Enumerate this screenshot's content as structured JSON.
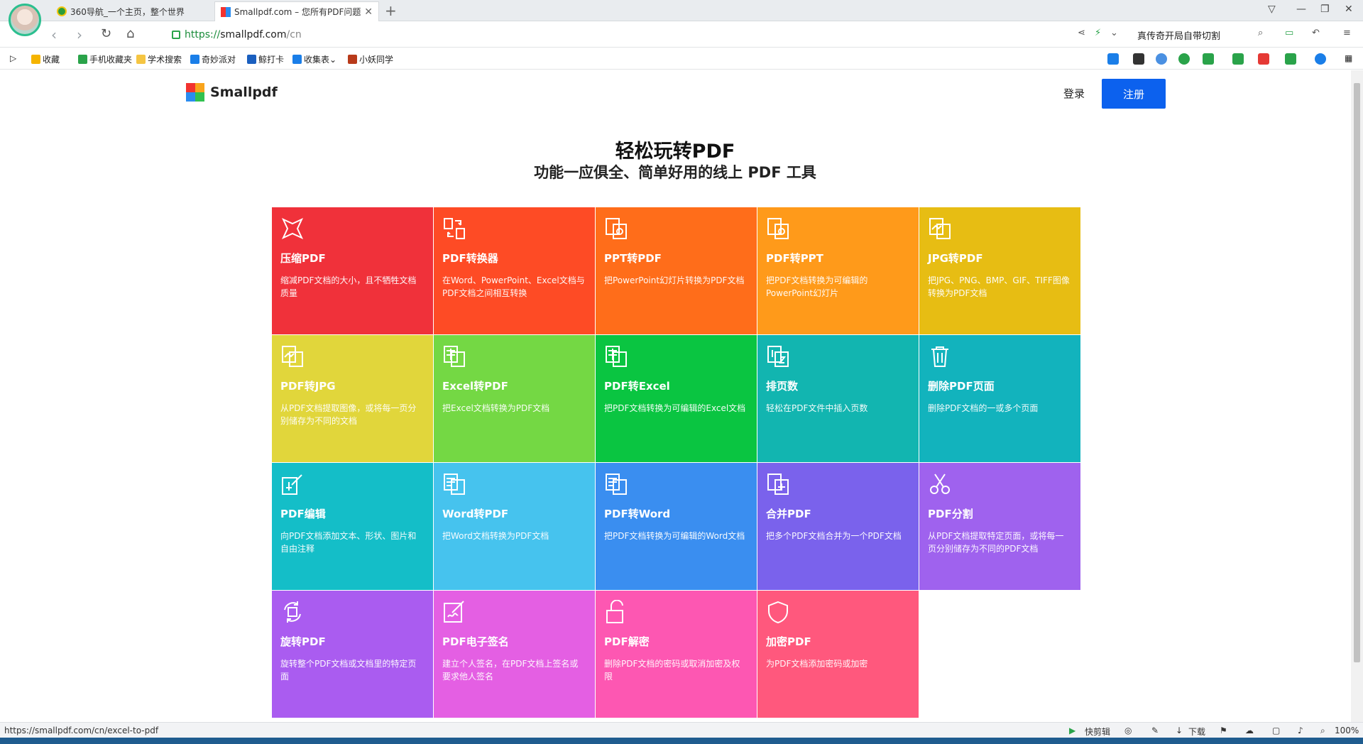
{
  "browser": {
    "tabs": [
      {
        "label": "360导航_一个主页，整个世界"
      },
      {
        "label": "Smallpdf.com – 您所有PDF问题",
        "active": true
      }
    ],
    "url": {
      "scheme": "https://",
      "host": "smallpdf.com",
      "path": "/cn"
    },
    "hot_search": "真传奇开局自带切割",
    "bookmarks": [
      "收藏",
      "手机收藏夹",
      "学术搜索",
      "奇妙派对",
      "鲸打卡",
      "收集表",
      "小妖同学"
    ],
    "status_url": "https://smallpdf.com/cn/excel-to-pdf",
    "status_right": {
      "clip": "快剪辑",
      "download": "下载",
      "zoom": "100%"
    }
  },
  "site": {
    "logo": "Smallpdf",
    "login": "登录",
    "signup": "注册",
    "hero_title": "轻松玩转PDF",
    "hero_subtitle": "功能一应俱全、简单好用的线上 PDF 工具"
  },
  "tools": [
    {
      "title": "压缩PDF",
      "desc": "缩减PDF文档的大小，且不牺牲文档质量",
      "color": "#f0313a",
      "icon": "compress-icon"
    },
    {
      "title": "PDF转换器",
      "desc": "在Word、PowerPoint、Excel文档与PDF文档之间相互转换",
      "color": "#fe4b25",
      "icon": "converter-icon"
    },
    {
      "title": "PPT转PDF",
      "desc": "把PowerPoint幻灯片转换为PDF文档",
      "color": "#ff6d1a",
      "icon": "ppt-icon"
    },
    {
      "title": "PDF转PPT",
      "desc": "把PDF文档转换为可编辑的PowerPoint幻灯片",
      "color": "#ff9a1a",
      "icon": "ppt-icon"
    },
    {
      "title": "JPG转PDF",
      "desc": "把JPG、PNG、BMP、GIF、TIFF图像转换为PDF文档",
      "color": "#e7bd13",
      "icon": "image-icon"
    },
    {
      "title": "PDF转JPG",
      "desc": "从PDF文档提取图像，或将每一页分别储存为不同的文档",
      "color": "#e1d63b",
      "icon": "image-icon"
    },
    {
      "title": "Excel转PDF",
      "desc": "把Excel文档转换为PDF文档",
      "color": "#74d844",
      "icon": "excel-icon"
    },
    {
      "title": "PDF转Excel",
      "desc": "把PDF文档转换为可编辑的Excel文档",
      "color": "#0ac541",
      "icon": "excel-icon"
    },
    {
      "title": "排页数",
      "desc": "轻松在PDF文件中插入页数",
      "color": "#12b5b0",
      "icon": "page-number-icon"
    },
    {
      "title": "删除PDF页面",
      "desc": "删除PDF文档的一或多个页面",
      "color": "#12b3bd",
      "icon": "trash-icon"
    },
    {
      "title": "PDF编辑",
      "desc": "向PDF文档添加文本、形状、图片和自由注释",
      "color": "#14bec8",
      "icon": "edit-icon"
    },
    {
      "title": "Word转PDF",
      "desc": "把Word文档转换为PDF文档",
      "color": "#46c3ee",
      "icon": "word-icon"
    },
    {
      "title": "PDF转Word",
      "desc": "把PDF文档转换为可编辑的Word文档",
      "color": "#3a8ef0",
      "icon": "word-icon"
    },
    {
      "title": "合并PDF",
      "desc": "把多个PDF文档合并为一个PDF文档",
      "color": "#7a62ec",
      "icon": "merge-icon"
    },
    {
      "title": "PDF分割",
      "desc": "从PDF文档提取特定页面，或将每一页分别储存为不同的PDF文档",
      "color": "#9f62ee",
      "icon": "scissors-icon"
    },
    {
      "title": "旋转PDF",
      "desc": "旋转整个PDF文档或文档里的特定页面",
      "color": "#aa5cf0",
      "icon": "rotate-icon"
    },
    {
      "title": "PDF电子签名",
      "desc": "建立个人签名，在PDF文档上签名或要求他人签名",
      "color": "#e45fe3",
      "icon": "sign-icon"
    },
    {
      "title": "PDF解密",
      "desc": "删除PDF文档的密码或取消加密及权限",
      "color": "#fd57b2",
      "icon": "unlock-icon"
    },
    {
      "title": "加密PDF",
      "desc": "为PDF文档添加密码或加密",
      "color": "#ff587d",
      "icon": "shield-icon"
    }
  ]
}
